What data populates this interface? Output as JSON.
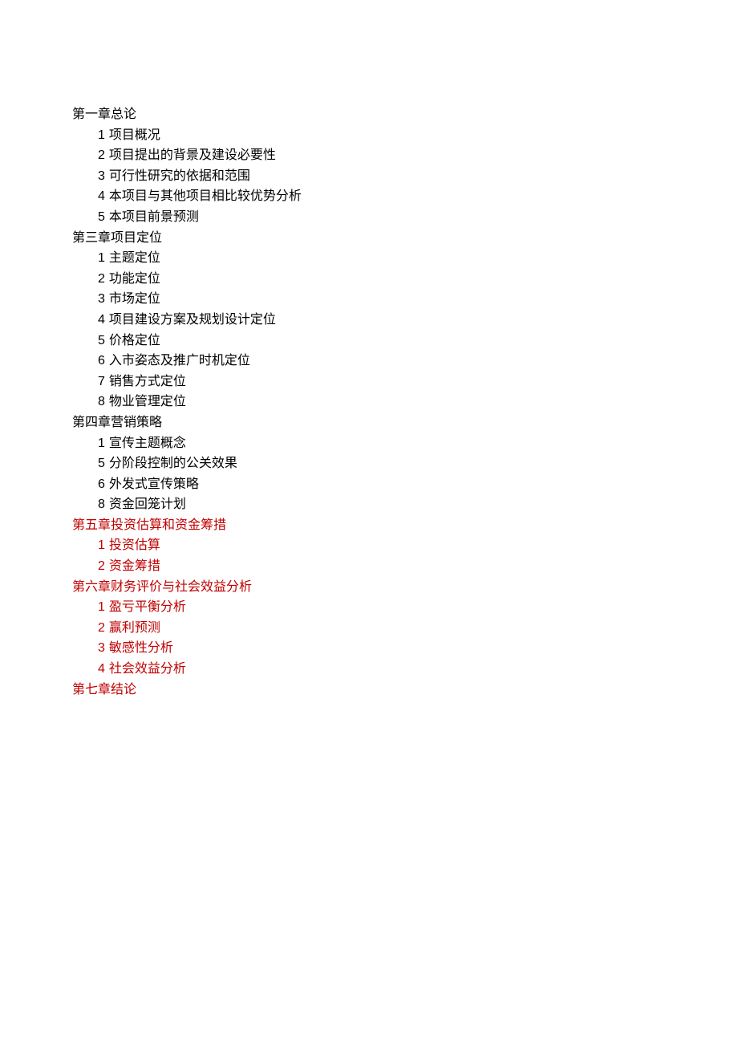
{
  "toc": {
    "chapters": [
      {
        "title": "第一章总论",
        "red": false,
        "items": [
          {
            "num": "1",
            "text": "项目概况"
          },
          {
            "num": "2",
            "text": "项目提出的背景及建设必要性"
          },
          {
            "num": "3",
            "text": "可行性研究的依据和范围"
          },
          {
            "num": "4",
            "text": "本项目与其他项目相比较优势分析"
          },
          {
            "num": "5",
            "text": "本项目前景预测"
          }
        ]
      },
      {
        "title": "第三章项目定位",
        "red": false,
        "items": [
          {
            "num": "1",
            "text": "主题定位"
          },
          {
            "num": "2",
            "text": "功能定位"
          },
          {
            "num": "3",
            "text": "市场定位"
          },
          {
            "num": "4",
            "text": "项目建设方案及规划设计定位"
          },
          {
            "num": "5",
            "text": "价格定位"
          },
          {
            "num": "6",
            "text": "入市姿态及推广时机定位"
          },
          {
            "num": "7",
            "text": "销售方式定位"
          },
          {
            "num": "8",
            "text": "物业管理定位"
          }
        ]
      },
      {
        "title": "第四章营销策略",
        "red": false,
        "items": [
          {
            "num": "1",
            "text": "宣传主题概念"
          },
          {
            "num": "5",
            "text": "分阶段控制的公关效果"
          },
          {
            "num": "6",
            "text": "外发式宣传策略"
          },
          {
            "num": "8",
            "text": "资金回笼计划"
          }
        ]
      },
      {
        "title": "第五章投资估算和资金筹措",
        "red": true,
        "items": [
          {
            "num": "1",
            "text": "投资估算"
          },
          {
            "num": "2",
            "text": "资金筹措"
          }
        ]
      },
      {
        "title": "第六章财务评价与社会效益分析",
        "red": true,
        "items": [
          {
            "num": "1",
            "text": "盈亏平衡分析"
          },
          {
            "num": "2",
            "text": "赢利预测"
          },
          {
            "num": "3",
            "text": "敏感性分析"
          },
          {
            "num": "4",
            "text": "社会效益分析"
          }
        ]
      },
      {
        "title": "第七章结论",
        "red": true,
        "items": []
      }
    ]
  }
}
